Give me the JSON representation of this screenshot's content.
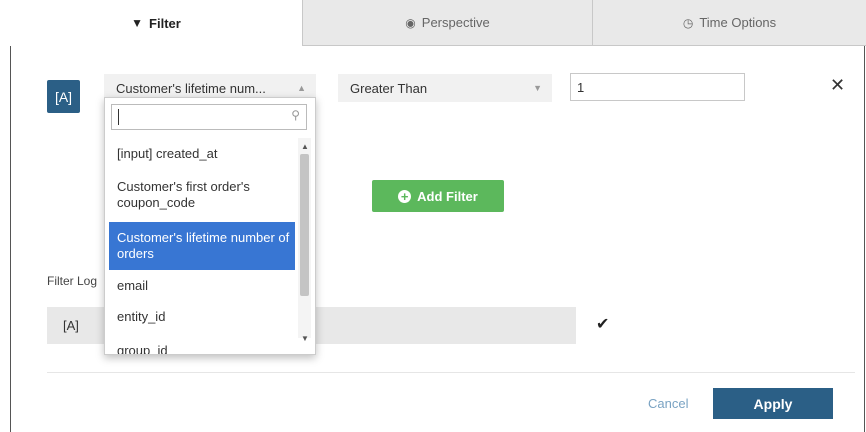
{
  "tabs": [
    {
      "label": "Filter",
      "icon": "filter-icon",
      "glyph": "▼"
    },
    {
      "label": "Perspective",
      "icon": "eye-icon",
      "glyph": "◉"
    },
    {
      "label": "Time Options",
      "icon": "clock-icon",
      "glyph": "◷"
    }
  ],
  "filter_row": {
    "alias": "[A]",
    "column_value": "Customer's lifetime num...",
    "operator_value": "Greater Than",
    "value_input": "1",
    "remove_glyph": "✕"
  },
  "dropdown": {
    "search_value": "",
    "options": [
      {
        "label": "[input] created_at",
        "selected": false
      },
      {
        "label": "Customer's first order's coupon_code",
        "selected": true
      },
      {
        "label": "Customer's lifetime number of orders",
        "selected": true
      },
      {
        "label": "email",
        "selected": false
      },
      {
        "label": "entity_id",
        "selected": false
      },
      {
        "label": "group_id",
        "selected": false
      }
    ]
  },
  "add_filter_label": "Add Filter",
  "filter_logic": {
    "label": "Filter Log",
    "value": "[A]",
    "confirm_glyph": "✔"
  },
  "footer": {
    "cancel_label": "Cancel",
    "apply_label": "Apply"
  },
  "colors": {
    "accent": "#2b5f86",
    "selected_option": "#3876d3",
    "add_button": "#5cb85c"
  }
}
